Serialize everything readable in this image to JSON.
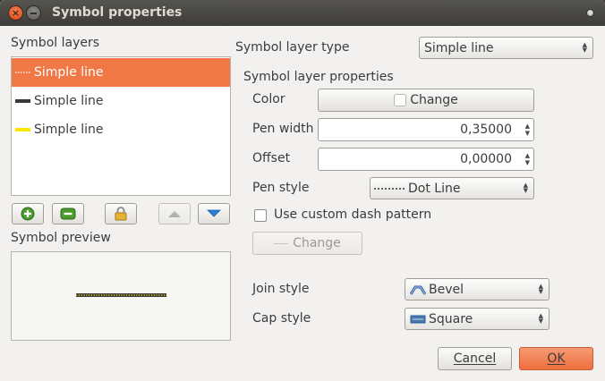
{
  "window": {
    "title": "Symbol properties",
    "accent_color": "#f07746"
  },
  "left": {
    "layers_heading": "Symbol layers",
    "layers": [
      {
        "label": "Simple line",
        "selected": true,
        "swatch": "dotted-white-line",
        "color": "#ffffff"
      },
      {
        "label": "Simple line",
        "selected": false,
        "swatch": "solid-dark-line",
        "color": "#3a3a3a"
      },
      {
        "label": "Simple line",
        "selected": false,
        "swatch": "solid-yellow-line",
        "color": "#ffe600"
      }
    ],
    "toolbar": [
      {
        "icon": "add-green-icon"
      },
      {
        "icon": "remove-green-icon"
      },
      {
        "icon": "lock-icon"
      },
      {
        "icon": "move-up-icon",
        "disabled": true
      },
      {
        "icon": "move-down-icon"
      }
    ],
    "preview_heading": "Symbol preview"
  },
  "right": {
    "layer_type_label": "Symbol layer type",
    "layer_type_value": "Simple line",
    "props_heading": "Symbol layer properties",
    "color_label": "Color",
    "color_button_label": "Change",
    "pen_width_label": "Pen width",
    "pen_width_value": "0,35000",
    "offset_label": "Offset",
    "offset_value": "0,00000",
    "pen_style_label": "Pen style",
    "pen_style_value": "Dot Line",
    "custom_dash_label": "Use custom dash pattern",
    "custom_dash_checked": false,
    "dash_change_label": "Change",
    "join_style_label": "Join style",
    "join_style_value": "Bevel",
    "cap_style_label": "Cap style",
    "cap_style_value": "Square"
  },
  "footer": {
    "cancel_label": "Cancel",
    "ok_label": "OK"
  }
}
